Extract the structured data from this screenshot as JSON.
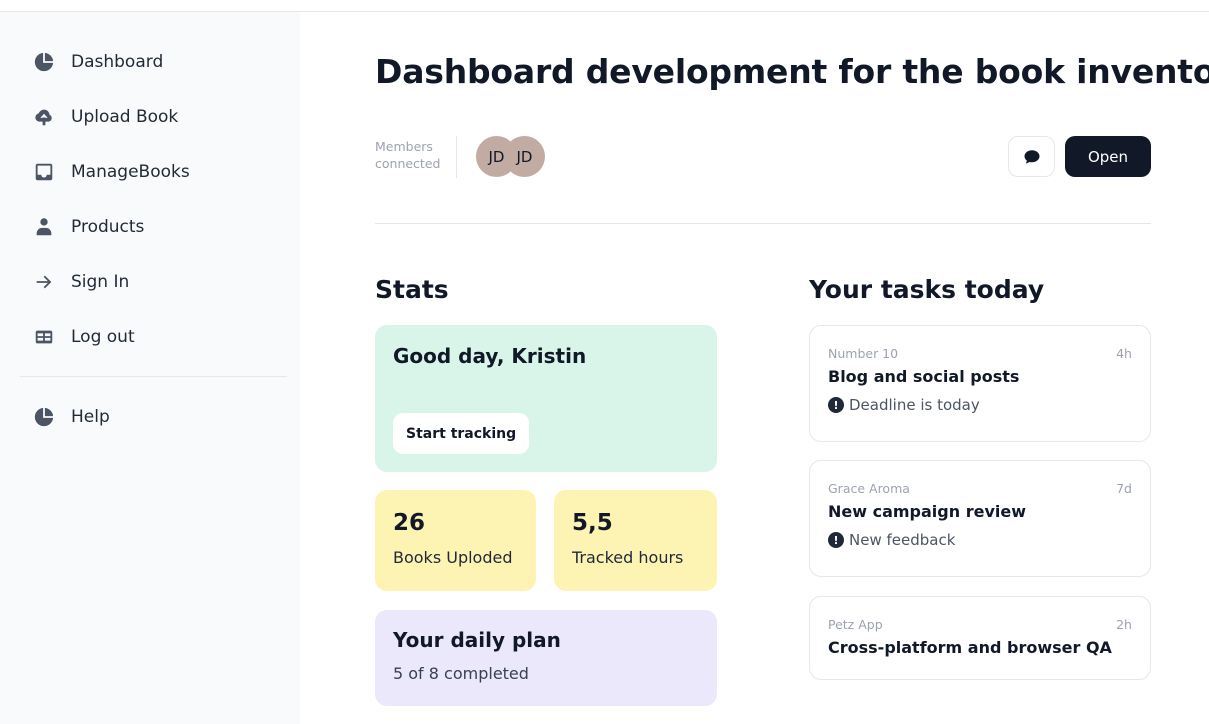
{
  "sidebar": {
    "items": [
      {
        "label": "Dashboard",
        "icon": "pie-chart-icon"
      },
      {
        "label": "Upload Book",
        "icon": "cloud-upload-icon"
      },
      {
        "label": "ManageBooks",
        "icon": "inbox-icon"
      },
      {
        "label": "Products",
        "icon": "user-icon"
      },
      {
        "label": "Sign In",
        "icon": "arrow-right-icon"
      },
      {
        "label": "Log out",
        "icon": "table-icon"
      }
    ],
    "secondary": [
      {
        "label": "Help",
        "icon": "pie-chart-icon"
      }
    ]
  },
  "header": {
    "title": "Dashboard development for the book inventory",
    "members_label": "Members connected",
    "avatars": [
      "JD",
      "JD"
    ],
    "chat_icon": "chat-bubble-icon",
    "open_label": "Open"
  },
  "stats": {
    "title": "Stats",
    "greeting": "Good day, Kristin",
    "track_label": "Start tracking",
    "books_value": "26",
    "books_label": "Books Uploded",
    "hours_value": "5,5",
    "hours_label": "Tracked hours",
    "plan_title": "Your daily plan",
    "plan_progress": "5 of 8 completed"
  },
  "tasks": {
    "title": "Your tasks today",
    "items": [
      {
        "client": "Number 10",
        "time": "4h",
        "title": "Blog and social posts",
        "note": "Deadline is today"
      },
      {
        "client": "Grace Aroma",
        "time": "7d",
        "title": "New campaign review",
        "note": "New feedback"
      },
      {
        "client": "Petz App",
        "time": "2h",
        "title": "Cross-platform and browser QA"
      }
    ]
  },
  "colors": {
    "green_card": "#d9f5ea",
    "yellow_card": "#fdf3b2",
    "purple_card": "#ebe8fb",
    "dark_button": "#111827",
    "avatar": "#c1aba3"
  }
}
